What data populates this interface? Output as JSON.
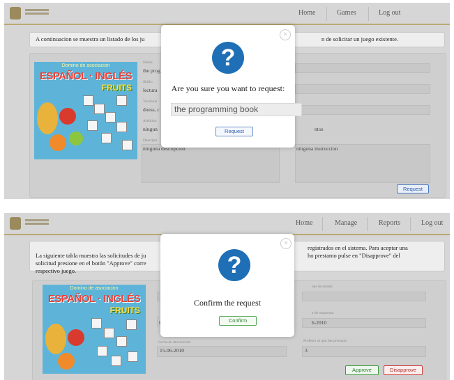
{
  "panel_top": {
    "nav": {
      "home": "Home",
      "games": "Games",
      "logout": "Log out"
    },
    "notice": "A continuacion se muestra un listado de los ju",
    "notice_right": "n de solicitar un juego existente.",
    "game": {
      "cover_top": "Domino de asociacion",
      "cover_title": "ESPAÑOL · INGLÉS",
      "cover_sub": "FRUITS",
      "name_label": "Name:",
      "name_value": "the prog",
      "skill_label": "Skills:",
      "skill_value": "lectura",
      "vocab_label": "Vocabula",
      "vocab_value": "doess, c",
      "additional_label": "Addition",
      "additional_value": "ningun",
      "desc_label": "Descripti",
      "desc_value": "ninguna descripcion",
      "right_value_1": "ntos",
      "right_value_2": "ninguna instruccion"
    },
    "modal": {
      "title": "Are you sure you want to request:",
      "input_value": "the programming book",
      "button": "Request",
      "close": "×"
    },
    "request_button": "Request"
  },
  "panel_bottom": {
    "nav": {
      "home": "Home",
      "manage": "Manage",
      "reports": "Reports",
      "logout": "Log out"
    },
    "notice_left": "La siguiente tabla muestra las solicitudes de ju\nsolicitud presione en el botón \"Approve\" corre\nrespectivo juego.",
    "notice_right": "registrados en el sistema. Para aceptar una\nho prestamo pulse en \"Disapprove\" del",
    "game": {
      "cover_top": "Domino de asociacion",
      "cover_title": "ESPAÑOL · INGLÉS",
      "cover_sub": "FRUITS",
      "left_label_1": "Fecha de devolución:",
      "left_value_1": "15-06-2010",
      "right_label_0": "nes de estado:",
      "right_label_1": "a de respuesta:",
      "right_value_1": "6-2010",
      "right_label_2": "Profesor al que fue prestado:",
      "right_value_2": "3",
      "left_value_0": "1"
    },
    "modal": {
      "title": "Confirm the request",
      "button": "Confirm",
      "close": "×"
    },
    "approve_button": "Approve",
    "disapprove_button": "Disapprove"
  },
  "colors": {
    "accent_blue": "#1e6fb5",
    "approve_green": "#3d9a3d",
    "disapprove_red": "#cc3a3a",
    "topbar_border": "#bba872"
  }
}
